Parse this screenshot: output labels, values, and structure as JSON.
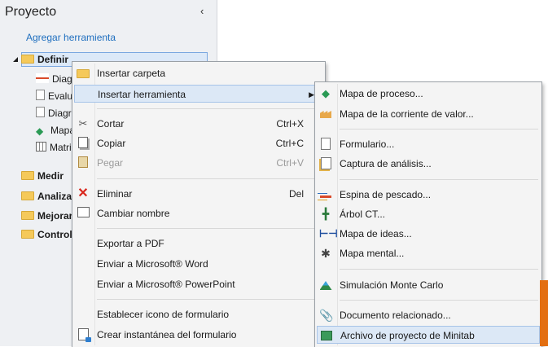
{
  "panel": {
    "title": "Proyecto",
    "add_tool": "Agregar herramienta",
    "tree": [
      {
        "label": "Definir",
        "bold": true
      },
      {
        "label": "Diagrama"
      },
      {
        "label": "Evaluación"
      },
      {
        "label": "Diagrama"
      },
      {
        "label": "Mapa"
      },
      {
        "label": "Matriz"
      },
      {
        "label": "Medir",
        "bold": true
      },
      {
        "label": "Analizar",
        "bold": true
      },
      {
        "label": "Mejorar",
        "bold": true
      },
      {
        "label": "Controlar",
        "bold": true
      }
    ]
  },
  "context_menu": {
    "items": [
      {
        "label": "Insertar carpeta",
        "icon": "folder-icon"
      },
      {
        "label": "Insertar herramienta",
        "icon": "",
        "submenu": true
      },
      {
        "label": "Cortar",
        "shortcut": "Ctrl+X",
        "icon": "scissors-icon"
      },
      {
        "label": "Copiar",
        "shortcut": "Ctrl+C",
        "icon": "copy-icon"
      },
      {
        "label": "Pegar",
        "shortcut": "Ctrl+V",
        "icon": "paste-icon",
        "disabled": true
      },
      {
        "label": "Eliminar",
        "shortcut": "Del",
        "icon": "delete-icon"
      },
      {
        "label": "Cambiar nombre",
        "icon": "rename-icon"
      },
      {
        "label": "Exportar a PDF"
      },
      {
        "label": "Enviar a Microsoft® Word"
      },
      {
        "label": "Enviar a Microsoft® PowerPoint"
      },
      {
        "label": "Establecer icono de formulario"
      },
      {
        "label": "Crear instantánea del formulario",
        "icon": "snapshot-icon"
      }
    ]
  },
  "submenu": {
    "items": [
      {
        "label": "Mapa de proceso...",
        "icon": "process-map-icon"
      },
      {
        "label": "Mapa de la corriente de valor...",
        "icon": "factory-icon"
      },
      {
        "label": "Formulario...",
        "icon": "form-icon"
      },
      {
        "label": "Captura de análisis...",
        "icon": "analysis-capture-icon"
      },
      {
        "label": "Espina de pescado...",
        "icon": "fishbone-icon"
      },
      {
        "label": "Árbol CT...",
        "icon": "ct-tree-icon"
      },
      {
        "label": "Mapa de ideas...",
        "icon": "idea-map-icon"
      },
      {
        "label": "Mapa mental...",
        "icon": "mind-map-icon"
      },
      {
        "label": "Simulación Monte Carlo",
        "icon": "monte-carlo-icon"
      },
      {
        "label": "Documento relacionado...",
        "icon": "paperclip-icon"
      },
      {
        "label": "Archivo de proyecto de Minitab",
        "icon": "minitab-project-icon"
      }
    ]
  },
  "colors": {
    "accent": "#1f6fbf",
    "hover": "#dce8f6",
    "orange": "#e36f12"
  }
}
